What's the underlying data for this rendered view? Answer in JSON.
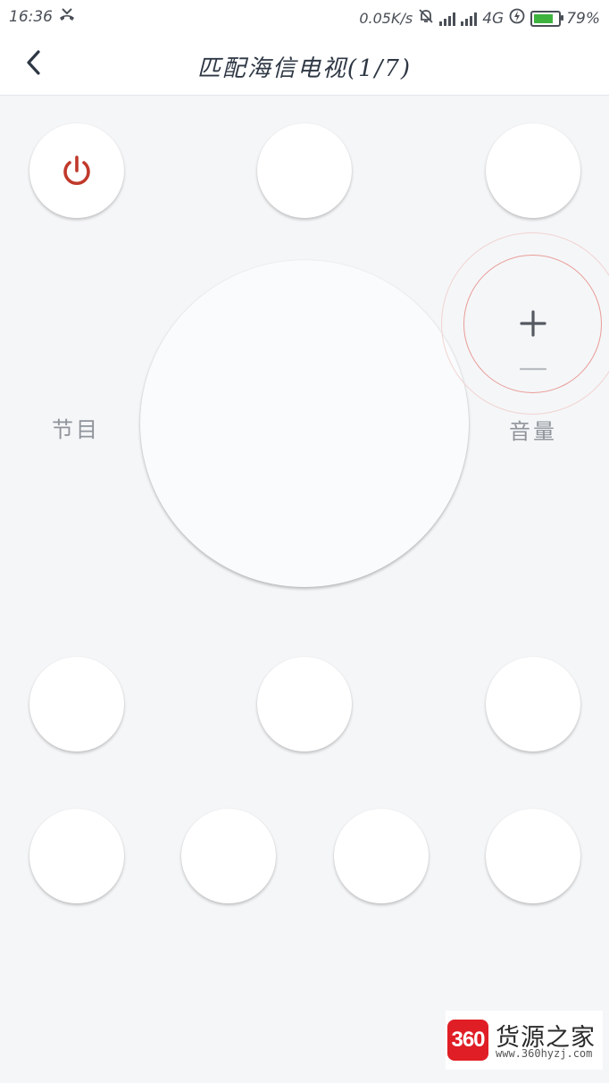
{
  "status_bar": {
    "time": "16:36",
    "net_speed": "0.05K/s",
    "network_type": "4G",
    "battery": "79%",
    "icons": [
      "missed-call-icon",
      "mute-bell-icon",
      "signal-icon",
      "signal-icon",
      "charging-icon",
      "battery-icon"
    ]
  },
  "header": {
    "back_icon": "chevron-left-icon",
    "title": "匹配海信电视(1/7)"
  },
  "remote": {
    "power_icon": "power-icon",
    "power_color": "#c0392b",
    "channel_label": "节目",
    "volume_label": "音量",
    "volume_plus_icon": "plus-icon",
    "volume_minus_icon": "minus-icon",
    "volume_ring_color": "#e89c97"
  },
  "watermark": {
    "badge": "360",
    "brand": "货源之家",
    "url": "www.360hyzj.com"
  }
}
